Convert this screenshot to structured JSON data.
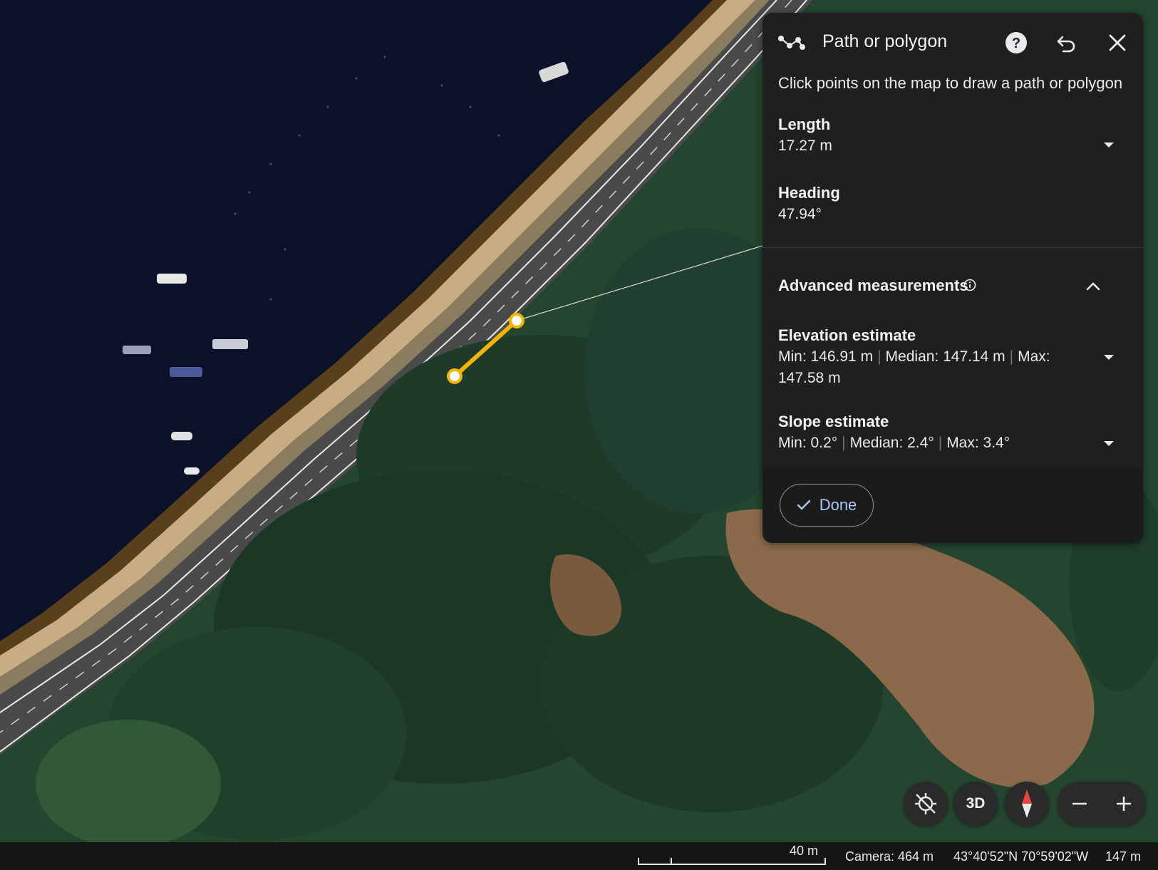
{
  "panel": {
    "title": "Path or polygon",
    "subtitle": "Click points on the map to draw a path or polygon",
    "length": {
      "label": "Length",
      "value": "17.27 m"
    },
    "heading": {
      "label": "Heading",
      "value": "47.94°"
    },
    "advanced": {
      "label": "Advanced measurements",
      "elevation": {
        "label": "Elevation estimate",
        "min": "Min: 146.91 m",
        "median": "Median: 147.14 m",
        "max": "Max:",
        "max_value": "147.58 m"
      },
      "slope": {
        "label": "Slope estimate",
        "min": "Min: 0.2°",
        "median": "Median: 2.4°",
        "max": "Max: 3.4°"
      }
    },
    "done_label": "Done",
    "separator": "|"
  },
  "controls": {
    "three_d_label": "3D"
  },
  "statusbar": {
    "scale": "40 m",
    "camera": "Camera: 464 m",
    "coordinates": "43°40'52\"N 70°59'02\"W",
    "elevation": "147 m"
  },
  "colors": {
    "measure_line": "#f6b400",
    "done_text": "#a8c7fa",
    "panel_bg": "#1f1f1f",
    "compass_red": "#e8453c"
  },
  "icons": [
    "path-icon",
    "help-icon",
    "undo-icon",
    "close-icon",
    "info-icon",
    "chevron-up-icon",
    "chevron-down-icon",
    "check-icon",
    "location-off-icon",
    "compass-icon",
    "zoom-out-icon",
    "zoom-in-icon"
  ]
}
